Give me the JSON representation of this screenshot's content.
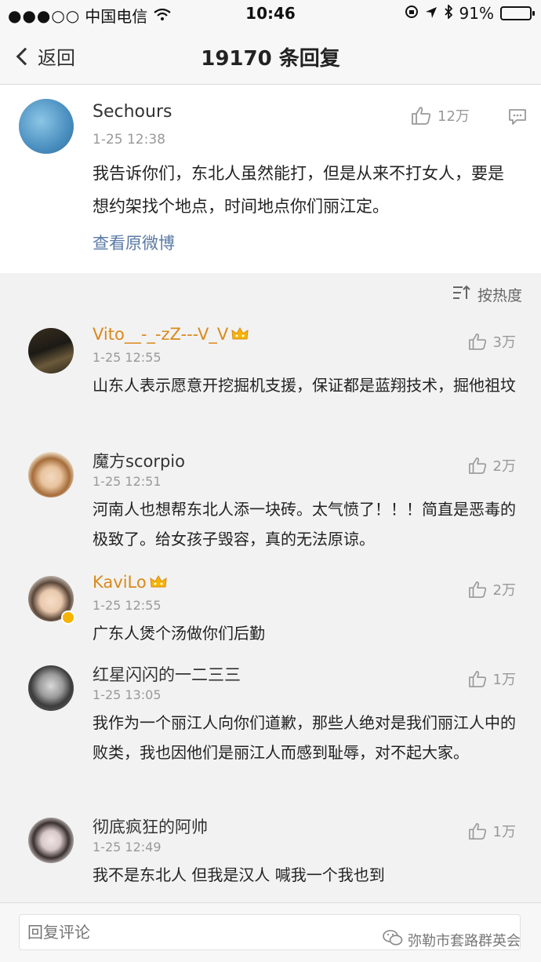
{
  "status_bar": {
    "signal": "●●●○○",
    "carrier": "中国电信",
    "time": "10:46",
    "battery_percent_text": "91%",
    "battery_level": 0.91
  },
  "nav": {
    "back_label": "返回",
    "title": "19170 条回复"
  },
  "post": {
    "username": "Sechours",
    "time": "1-25 12:38",
    "likes": "12万",
    "content": "我告诉你们，东北人虽然能打，但是从来不打女人，要是想约架找个地点，时间地点你们丽江定。",
    "view_original": "查看原微博"
  },
  "sort": {
    "label": "按热度"
  },
  "replies": [
    {
      "username": "Vito__-_-zZ---V_V",
      "time": "1-25 12:55",
      "likes": "3万",
      "content": "山东人表示愿意开挖掘机支援，保证都是蓝翔技术，掘他祖坟"
    },
    {
      "username": "魔方scorpio",
      "time": "1-25 12:51",
      "likes": "2万",
      "content": "河南人也想帮东北人添一块砖。太气愤了！！！简直是恶毒的极致了。给女孩子毁容，真的无法原谅。"
    },
    {
      "username": "KaviLo",
      "time": "1-25 12:55",
      "likes": "2万",
      "content": "广东人煲个汤做你们后勤"
    },
    {
      "username": "红星闪闪的一二三三",
      "time": "1-25 13:05",
      "likes": "1万",
      "content": "我作为一个丽江人向你们道歉，那些人绝对是我们丽江人中的败类，我也因他们是丽江人而感到耻辱，对不起大家。"
    },
    {
      "username": "彻底疯狂的阿帅",
      "time": "1-25 12:49",
      "likes": "1万",
      "content": "我不是东北人 但我是汉人 喊我一个我也到"
    }
  ],
  "bottom": {
    "placeholder": "回复评论",
    "watermark": "弥勒市套路群英会"
  },
  "colors": {
    "gold_username": "#d98a1b",
    "link_blue": "#5a7aa6",
    "vip_crown": "#f6b400"
  }
}
